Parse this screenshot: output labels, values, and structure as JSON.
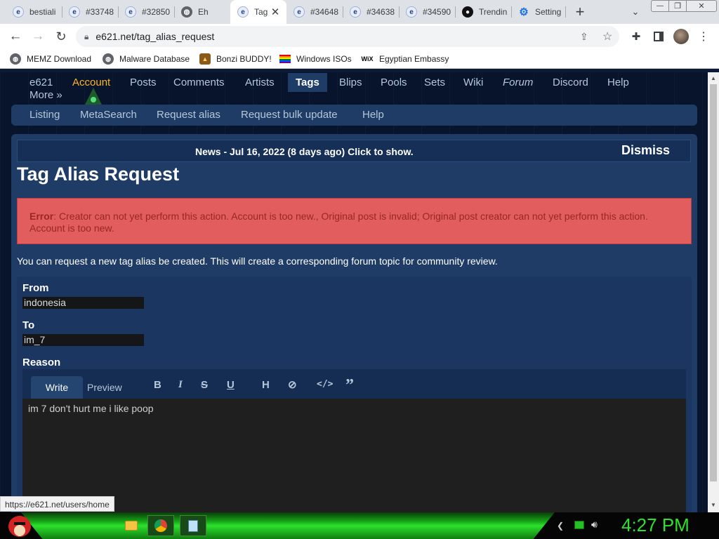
{
  "browser": {
    "tabs": [
      {
        "label": "bestiali",
        "icon": "e621-icon"
      },
      {
        "label": "#33748",
        "icon": "e621-icon"
      },
      {
        "label": "#32850",
        "icon": "e621-icon"
      },
      {
        "label": "Eh",
        "icon": "globe-icon"
      },
      {
        "label": "Tag",
        "icon": "e621-icon",
        "active": true
      },
      {
        "label": "#34648",
        "icon": "e621-icon"
      },
      {
        "label": "#34638",
        "icon": "e621-icon"
      },
      {
        "label": "#34590",
        "icon": "e621-icon"
      },
      {
        "label": "Trendin",
        "icon": "github-icon"
      },
      {
        "label": "Setting",
        "icon": "gear-icon"
      }
    ],
    "url": "e621.net/tag_alias_request",
    "bookmarks": [
      "MEMZ Download",
      "Malware Database",
      "Bonzi BUDDY!",
      "Windows ISOs",
      "Egyptian Embassy"
    ]
  },
  "site": {
    "nav_main": [
      "e621",
      "Account",
      "Posts",
      "Comments",
      "Artists",
      "Tags",
      "Blips",
      "Pools",
      "Sets",
      "Wiki",
      "Forum",
      "Discord",
      "Help",
      "More »"
    ],
    "nav_sub": [
      "Listing",
      "MetaSearch",
      "Request alias",
      "Request bulk update",
      "Help"
    ],
    "news": "News - Jul 16, 2022 (8 days ago) Click to show.",
    "dismiss": "Dismiss",
    "heading": "Tag Alias Request",
    "error_label": "Error",
    "error_text": ": Creator can not yet perform this action. Account is too new., Original post is invalid; Original post creator can not yet perform this action. Account is too new.",
    "intro": "You can request a new tag alias be created. This will create a corresponding forum topic for community review.",
    "form": {
      "from_label": "From",
      "from_value": "indonesia",
      "to_label": "To",
      "to_value": "im_7",
      "reason_label": "Reason",
      "write_tab": "Write",
      "preview_tab": "Preview",
      "reason_text": "im 7 don't hurt me i like poop"
    }
  },
  "status_url": "https://e621.net/users/home",
  "taskbar": {
    "clock": "4:27 PM"
  },
  "colors": {
    "link": "#b4c7d9",
    "account": "#fcb328",
    "error_bg": "#e15d5e",
    "page_bg": "#08142b",
    "section_bg": "#1f3c67"
  }
}
